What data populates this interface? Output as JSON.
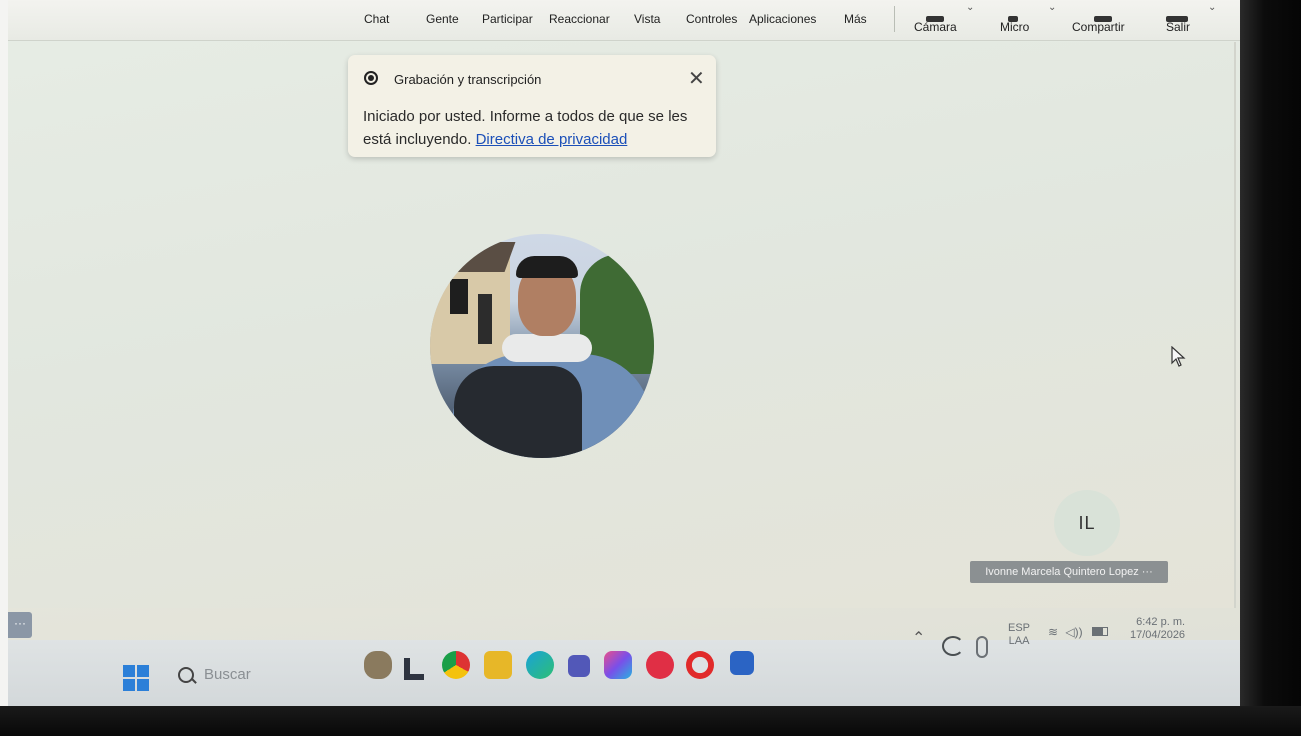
{
  "toolbar": {
    "items": [
      "Chat",
      "Gente",
      "Participar",
      "Reaccionar",
      "Vista",
      "Controles",
      "Aplicaciones",
      "Más"
    ],
    "camera_label": "Cámara",
    "mic_label": "Micro",
    "share_label": "Compartir",
    "leave_label": "Salir"
  },
  "notification": {
    "title": "Grabación y transcripción",
    "body": "Iniciado por usted. Informe a todos de que se les está incluyendo.",
    "link": "Directiva de privacidad",
    "close_icon": "close-icon"
  },
  "participant": {
    "initials": "IL",
    "name": "Ivonne Marcela Quintero Lopez",
    "more": "···"
  },
  "side_more": "···",
  "taskbar": {
    "search_placeholder": "Buscar",
    "tray": {
      "language": "ESP",
      "layout": "LAA",
      "time": "6:42 p. m.",
      "date": "17/04/2026"
    }
  },
  "colors": {
    "accent": "#1b4fb8",
    "start": "#2b7fd8"
  }
}
